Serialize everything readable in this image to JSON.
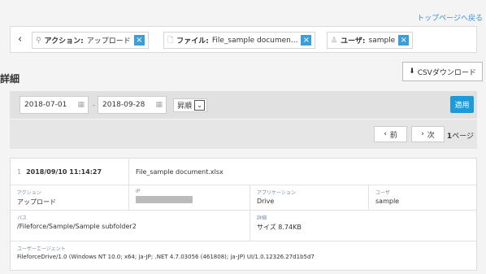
{
  "header": {
    "top_link": "トップページへ戻る"
  },
  "filters": {
    "back": "‹",
    "chips": [
      {
        "icon": "search-icon",
        "glyph": "⚲",
        "key": "アクション:",
        "value": "アップロード"
      },
      {
        "icon": "file-icon",
        "glyph": "🗋",
        "key": "ファイル:",
        "value": "File_sample documen..."
      },
      {
        "icon": "user-icon",
        "glyph": "♙",
        "key": "ユーザ:",
        "value": "sample"
      }
    ],
    "remove": "×"
  },
  "section": {
    "title": "詳細",
    "csv_label": "CSVダウンロード",
    "csv_icon": "⬇"
  },
  "search": {
    "date_from": "2018-07-01",
    "date_to": "2018-09-28",
    "separator": "-",
    "sort": "昇順",
    "apply": "適用",
    "cal": "▦",
    "sort_arrow": "⌄"
  },
  "pager": {
    "prev": "前",
    "next": "次",
    "prev_glyph": "‹",
    "next_glyph": "›",
    "page_num": "1",
    "page_suffix": "ページ"
  },
  "record": {
    "index": "1",
    "timestamp": "2018/09/10 11:14:27",
    "filename": "File_sample document.xlsx",
    "labels": {
      "action": "アクション",
      "ip": "IP",
      "app": "アプリケーション",
      "user": "ユーザ",
      "path": "パス",
      "detail": "詳細",
      "ua": "ユーザーエージェント"
    },
    "action": "アップロード",
    "app": "Drive",
    "user": "sample",
    "path": "/Fileforce/Sample/Sample subfolder2",
    "size": "サイズ 8.74KB",
    "ua": "FileforceDrive/1.0 (Windows NT 10.0; x64; ja-JP; .NET 4.7.03056 (461808); ja-JP) UI/1.0.12326.27d1b5d7"
  }
}
